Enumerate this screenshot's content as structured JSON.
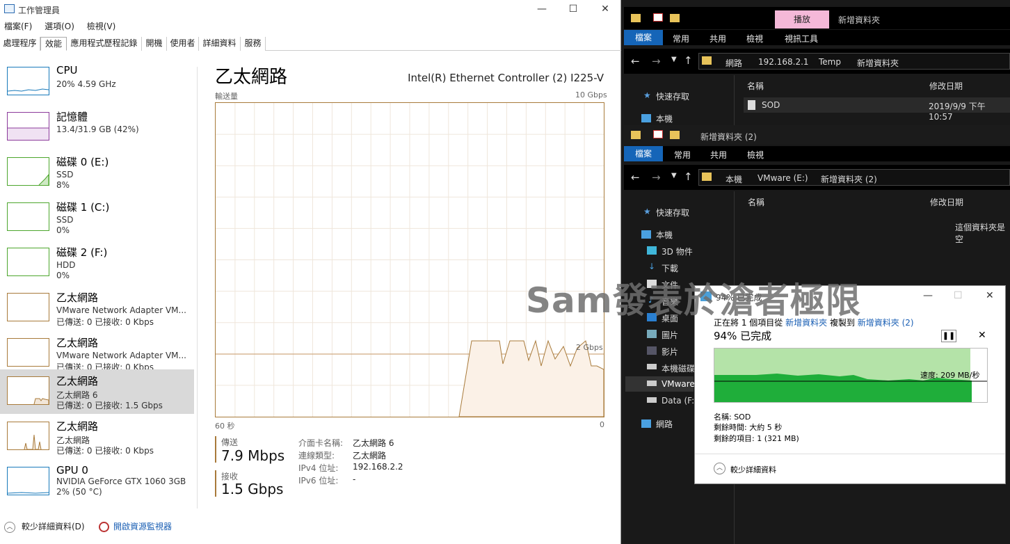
{
  "task_manager": {
    "title": "工作管理員",
    "menu": [
      "檔案(F)",
      "選項(O)",
      "檢視(V)"
    ],
    "tabs": [
      "處理程序",
      "效能",
      "應用程式歷程記錄",
      "開機",
      "使用者",
      "詳細資料",
      "服務"
    ],
    "side_items": [
      {
        "name": "CPU",
        "line1": "20%  4.59 GHz",
        "line2": "",
        "color": "#1779ba"
      },
      {
        "name": "記憶體",
        "line1": "13.4/31.9 GB (42%)",
        "line2": "",
        "color": "#8b3a9b"
      },
      {
        "name": "磁碟 0 (E:)",
        "line1": "SSD",
        "line2": "8%",
        "color": "#4ca62c"
      },
      {
        "name": "磁碟 1 (C:)",
        "line1": "SSD",
        "line2": "0%",
        "color": "#4ca62c"
      },
      {
        "name": "磁碟 2 (F:)",
        "line1": "HDD",
        "line2": "0%",
        "color": "#4ca62c"
      },
      {
        "name": "乙太網路",
        "line1": "VMware Network Adapter VM...",
        "line2": "已傳送: 0 已接收: 0 Kbps",
        "color": "#a87a3a"
      },
      {
        "name": "乙太網路",
        "line1": "VMware Network Adapter VM...",
        "line2": "已傳送: 0 已接收: 0 Kbps",
        "color": "#a87a3a"
      },
      {
        "name": "乙太網路",
        "line1": "乙太網路 6",
        "line2": "已傳送: 0 已接收: 1.5 Gbps",
        "color": "#a87a3a"
      },
      {
        "name": "乙太網路",
        "line1": "乙太網路",
        "line2": "已傳送: 0 已接收: 0 Kbps",
        "color": "#a87a3a"
      },
      {
        "name": "GPU 0",
        "line1": "NVIDIA GeForce GTX 1060 3GB",
        "line2": "2% (50 °C)",
        "color": "#1779ba"
      }
    ],
    "main": {
      "title": "乙太網路",
      "adapter": "Intel(R) Ethernet Controller (2) I225-V",
      "graph_label": "輸送量",
      "graph_max": "10 Gbps",
      "graph_mid": "2 Gbps",
      "x_left": "60 秒",
      "x_right": "0",
      "send_label": "傳送",
      "send_value": "7.9 Mbps",
      "recv_label": "接收",
      "recv_value": "1.5 Gbps",
      "details": [
        {
          "k": "介面卡名稱:",
          "v": "乙太網路 6"
        },
        {
          "k": "連線類型:",
          "v": "乙太網路"
        },
        {
          "k": "IPv4 位址:",
          "v": "192.168.2.2"
        },
        {
          "k": "IPv6 位址:",
          "v": "-"
        }
      ]
    },
    "footer": {
      "fewer": "較少詳細資料(D)",
      "monitor": "開啟資源監視器"
    }
  },
  "explorer1": {
    "title_tab": "播放",
    "title": "新增資料夾",
    "ribbon": [
      "檔案",
      "常用",
      "共用",
      "檢視",
      "視訊工具"
    ],
    "crumbs": [
      "網路",
      "192.168.2.1",
      "Temp",
      "新增資料夾"
    ],
    "nav": [
      "快速存取",
      "本機"
    ],
    "col_name": "名稱",
    "col_date": "修改日期",
    "file_name": "SOD",
    "file_date": "2019/9/9 下午 10:57"
  },
  "explorer2": {
    "title": "新增資料夾 (2)",
    "ribbon": [
      "檔案",
      "常用",
      "共用",
      "檢視"
    ],
    "crumbs": [
      "本機",
      "VMware (E:)",
      "新增資料夾 (2)"
    ],
    "nav": [
      "快速存取",
      "本機",
      "3D 物件",
      "下載",
      "文件",
      "音樂",
      "桌面",
      "圖片",
      "影片",
      "本機磁碟",
      "VMware",
      "Data (F:)",
      "網路"
    ],
    "col_name": "名稱",
    "col_date": "修改日期",
    "empty": "這個資料夾是空"
  },
  "copy_dialog": {
    "title": "94% 已完成",
    "line": "正在將 1 個項目從",
    "from": "新增資料夾",
    "mid": "複製到",
    "to": "新增資料夾 (2)",
    "progress_text": "94% 已完成",
    "progress": 0.94,
    "speed": "速度: 209 MB/秒",
    "name": "名稱: SOD",
    "remaining_time": "剩餘時間: 大約 5 秒",
    "remaining_items": "剩餘的項目: 1 (321 MB)",
    "fewer": "較少詳細資料"
  },
  "watermark": "Sam發表於滄者極限"
}
